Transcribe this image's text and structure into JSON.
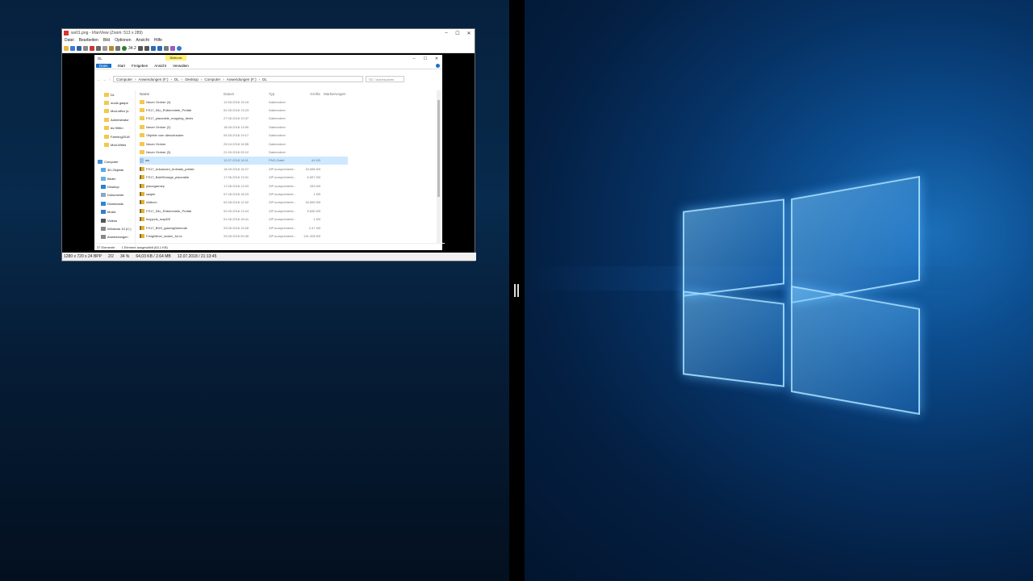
{
  "viewer": {
    "title": "ws01.png - IrfanView (Zoom: 513 x 289)",
    "window_controls": [
      "–",
      "☐",
      "✕"
    ],
    "menu": [
      "Datei",
      "Bearbeiten",
      "Bild",
      "Optionen",
      "Ansicht",
      "Hilfe"
    ],
    "zoom_value": "34.2",
    "status": {
      "dimensions": "1280 x 720 x 24 BPP",
      "page": "2/2",
      "zoom": "34 %",
      "size": "64,03 KB / 2.64 MB",
      "datetime": "12.07.2018 / 21:13:45"
    }
  },
  "explorer": {
    "title": "DL",
    "context_tab": "Bildtools",
    "window_controls": [
      "–",
      "☐",
      "✕"
    ],
    "tabs": [
      "Datei",
      "Start",
      "Freigeben",
      "Ansicht",
      "Verwalten"
    ],
    "path": [
      "Computer",
      "Anwendungen (F:)",
      "DL",
      "Desktop",
      "Computer",
      "Anwendungen (F:)",
      "DL"
    ],
    "search_placeholder": "\"DL\" durchsuchen",
    "columns": {
      "name": "Name",
      "date": "Datum",
      "type": "Typ",
      "size": "Größe",
      "tags": "Markierungen"
    },
    "nav_items": [
      {
        "label": "DL",
        "icon": "folder"
      },
      {
        "label": "mods gaspe",
        "icon": "folder"
      },
      {
        "label": "Mod-offen (s",
        "icon": "folder"
      },
      {
        "label": "Adminstrator",
        "icon": "folder"
      },
      {
        "label": "ds Hilfen",
        "icon": "folder"
      },
      {
        "label": "Farming2018",
        "icon": "folder"
      },
      {
        "label": "Mod-Webs",
        "icon": "folder"
      },
      {
        "label": "",
        "icon": "none"
      },
      {
        "label": "Computer",
        "icon": "computer"
      },
      {
        "label": "3D-Objekte",
        "icon": "cube"
      },
      {
        "label": "Bilder",
        "icon": "pictures"
      },
      {
        "label": "Desktop",
        "icon": "desktop"
      },
      {
        "label": "Dokumente",
        "icon": "documents"
      },
      {
        "label": "Downloads",
        "icon": "downloads"
      },
      {
        "label": "Musik",
        "icon": "music"
      },
      {
        "label": "Videos",
        "icon": "videos"
      },
      {
        "label": "Windows 10 (C:)",
        "icon": "drive"
      },
      {
        "label": "Anwendungen",
        "icon": "drive"
      }
    ],
    "files": [
      {
        "name": "Neuer Ordner (4)",
        "date": "12.06.2018 15:15",
        "type": "Dateiordner",
        "size": "",
        "kind": "folder"
      },
      {
        "name": "FS17_Silo_Rübenmiete_Prefab",
        "date": "02.05.2018 13:23",
        "type": "Dateiordner",
        "size": "",
        "kind": "folder"
      },
      {
        "name": "FS17_placeable_mapping_items",
        "date": "27.05.2018 19:37",
        "type": "Dateiordner",
        "size": "",
        "kind": "folder"
      },
      {
        "name": "Neuer Ordner (2)",
        "date": "18.05.2018 13:00",
        "type": "Dateiordner",
        "size": "",
        "kind": "folder"
      },
      {
        "name": "Objekte vom dieschrauber",
        "date": "04.05.2018 19:17",
        "type": "Dateiordner",
        "size": "",
        "kind": "folder"
      },
      {
        "name": "Neuer Ordner",
        "date": "25.04.2018 16:55",
        "type": "Dateiordner",
        "size": "",
        "kind": "folder"
      },
      {
        "name": "Neuer Ordner (3)",
        "date": "21.05.2018 09:12",
        "type": "Dateiordner",
        "size": "",
        "kind": "folder"
      },
      {
        "name": "ws",
        "date": "12.07.2018 18:11",
        "type": "PNG-Datei",
        "size": "64 KB",
        "kind": "png"
      },
      {
        "name": "FS17_Advanced_Animals_prefab",
        "date": "18.05.2018 16:27",
        "type": "ZIP-komprimierte...",
        "size": "16.658 KB",
        "kind": "zip"
      },
      {
        "name": "FS17_BaleStorage_placeable",
        "date": "17.06.2018 13:01",
        "type": "ZIP-komprimierte...",
        "size": "6.597 KB",
        "kind": "zip"
      },
      {
        "name": "placegarmey",
        "date": "17.06.2018 13:03",
        "type": "ZIP-komprimierte...",
        "size": "253 KB",
        "kind": "zip"
      },
      {
        "name": "sasjek",
        "date": "07.06.2018 18:23",
        "type": "ZIP-komprimierte...",
        "size": "1 KB",
        "kind": "zip"
      },
      {
        "name": "sildbcm",
        "date": "02.06.2018 12:02",
        "type": "ZIP-komprimierte...",
        "size": "34.695 KB",
        "kind": "zip"
      },
      {
        "name": "FS17_Silo_Rübenmiete_Prefab",
        "date": "02.05.2018 13:24",
        "type": "ZIP-komprimierte...",
        "size": "5.836 KB",
        "kind": "zip"
      },
      {
        "name": "fsoppcis_mapDE",
        "date": "01.06.2018 18:41",
        "type": "ZIP-komprimierte...",
        "size": "1 KB",
        "kind": "zip"
      },
      {
        "name": "FS17_BHS_gasengfahrende",
        "date": "29.05.2018 19:26",
        "type": "ZIP-komprimierte...",
        "size": "2.47 KB",
        "kind": "zip"
      },
      {
        "name": "Freightliner_tanker_for.rs",
        "date": "29.05.2018 09:35",
        "type": "ZIP-komprimierte...",
        "size": "131.328 KB",
        "kind": "zip"
      }
    ],
    "status": {
      "count": "37 Elemente",
      "selected": "1 Element ausgewählt (63,1 KB)"
    }
  },
  "colors": {
    "accent": "#1a6fc6",
    "selection": "#cde8ff",
    "folder": "#f2c94c"
  }
}
